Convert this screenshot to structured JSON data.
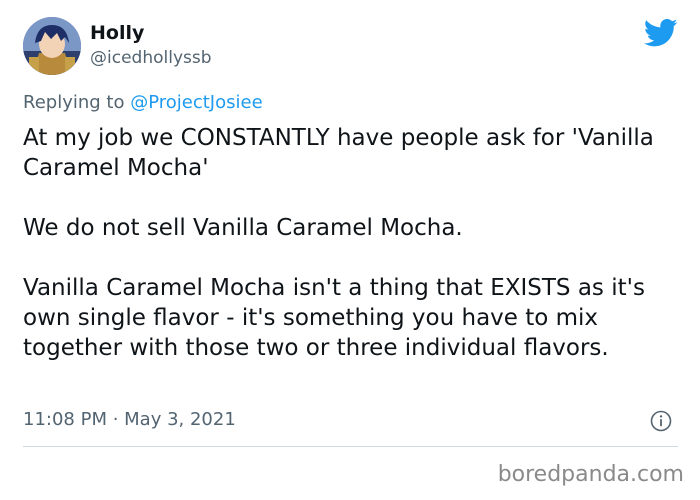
{
  "tweet": {
    "display_name": "Holly",
    "handle": "@icedhollyssb",
    "reply_prefix": "Replying to",
    "reply_to": "@ProjectJosiee",
    "paragraphs": [
      "At my job we CONSTANTLY have people ask for 'Vanilla Caramel Mocha'",
      "We do not sell Vanilla Caramel Mocha.",
      "Vanilla Caramel Mocha isn't a thing that EXISTS as it's own single flavor - it's something you have to mix together with those two or three individual flavors."
    ],
    "timestamp": "11:08 PM · May 3, 2021",
    "icons": {
      "brand": "twitter-bird-icon",
      "info": "info-icon"
    },
    "colors": {
      "brand": "#1d9bf0",
      "secondary_text": "#536471",
      "text": "#0f1419"
    }
  },
  "watermark": "boredpanda.com"
}
